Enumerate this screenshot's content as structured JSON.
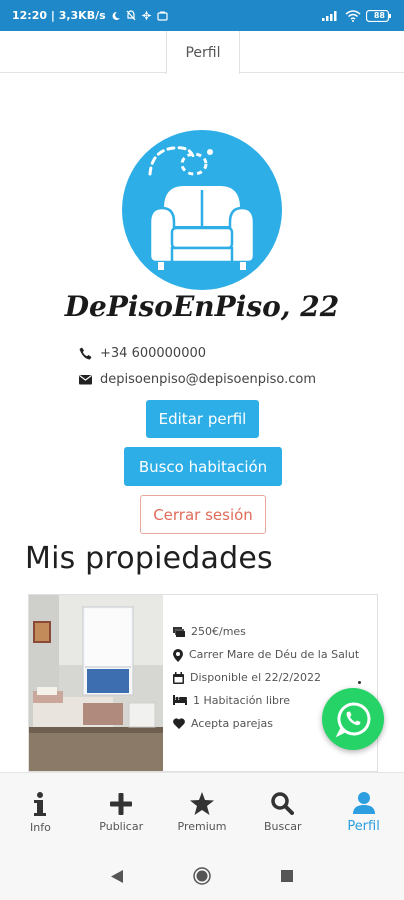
{
  "status_bar": {
    "time_info": "12:20 | 3,3KB/s",
    "battery": "88"
  },
  "tab": {
    "label": "Perfil"
  },
  "profile": {
    "name": "DePisoEnPiso, 22",
    "phone": "+34 600000000",
    "email": "depisoenpiso@depisoenpiso.com",
    "edit_label": "Editar perfil",
    "search_label": "Busco habitación",
    "logout_label": "Cerrar sesión"
  },
  "properties": {
    "title": "Mis propiedades",
    "items": [
      {
        "price": "250€/mes",
        "address": "Carrer Mare de Déu de la Salut",
        "available": "Disponible el 22/2/2022",
        "rooms": "1 Habitación libre",
        "couples": "Acepta parejas"
      }
    ]
  },
  "nav": {
    "items": [
      {
        "label": "Info",
        "icon": "info-icon"
      },
      {
        "label": "Publicar",
        "icon": "plus-icon"
      },
      {
        "label": "Premium",
        "icon": "star-icon"
      },
      {
        "label": "Buscar",
        "icon": "search-icon"
      },
      {
        "label": "Perfil",
        "icon": "user-icon",
        "active": true
      }
    ]
  },
  "colors": {
    "accent": "#2eaee6",
    "status_bar": "#1e88c8",
    "danger": "#e06b5a",
    "whatsapp": "#25d366"
  }
}
